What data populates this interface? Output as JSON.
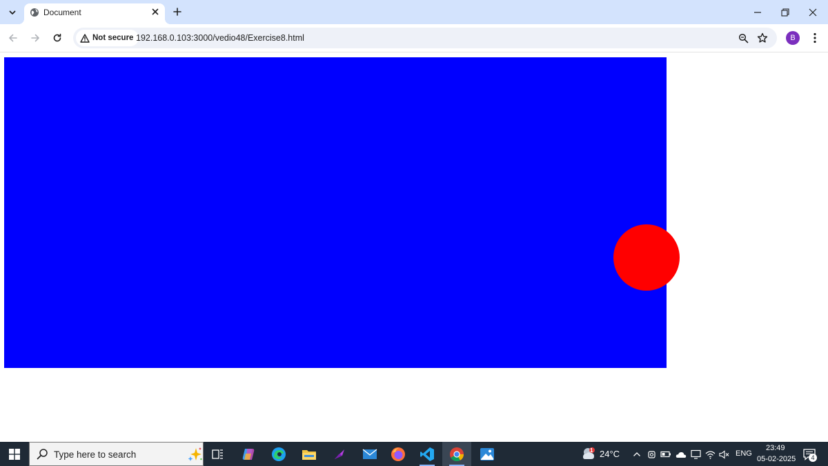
{
  "browser": {
    "tab": {
      "title": "Document"
    },
    "toolbar": {
      "security_label": "Not secure",
      "url": "192.168.0.103:3000/vedio48/Exercise8.html"
    },
    "profile_initial": "B"
  },
  "page": {
    "box_color": "#0000ff",
    "ball_color": "#ff0000"
  },
  "taskbar": {
    "search_placeholder": "Type here to search",
    "weather": {
      "temperature": "24°C",
      "alert_count": "1"
    },
    "language": "ENG",
    "clock": {
      "time": "23:49",
      "date": "05-02-2025"
    },
    "notification_count": "4",
    "apps": [
      "task-view",
      "copilot",
      "edge",
      "file-explorer",
      "app-launcher",
      "mail",
      "firefox",
      "vscode",
      "chrome",
      "photos"
    ]
  }
}
